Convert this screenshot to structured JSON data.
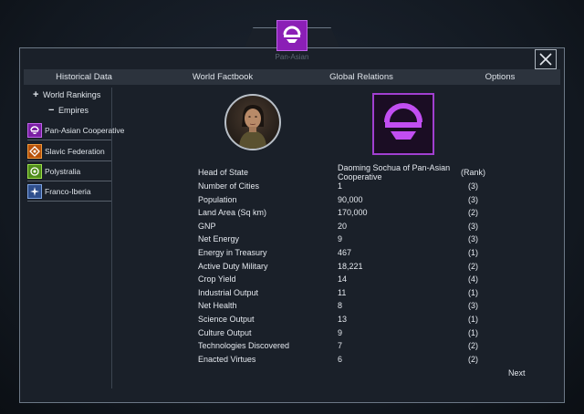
{
  "header": {
    "caption": "Pan-Asian"
  },
  "tabs": [
    {
      "label": "Historical Data"
    },
    {
      "label": "World Factbook"
    },
    {
      "label": "Global Relations"
    },
    {
      "label": "Options"
    }
  ],
  "sidebar": {
    "world_rankings": {
      "symbol": "+",
      "label": "World Rankings"
    },
    "empires_toggle": {
      "symbol": "−",
      "label": "Empires"
    },
    "empires": [
      {
        "label": "Pan-Asian Cooperative",
        "color": "#a62bd4"
      },
      {
        "label": "Slavic Federation",
        "color": "#e07a12"
      },
      {
        "label": "Polystralia",
        "color": "#7bc62a"
      },
      {
        "label": "Franco-Iberia",
        "color": "#4f78c6"
      }
    ]
  },
  "leader": {
    "label": "Head of State",
    "value": "Daoming Sochua of Pan-Asian Cooperative",
    "rank_header": "(Rank)"
  },
  "stats": [
    {
      "label": "Number of Cities",
      "value": "1",
      "rank": "(3)"
    },
    {
      "label": "Population",
      "value": "90,000",
      "rank": "(3)"
    },
    {
      "label": "Land Area (Sq km)",
      "value": "170,000",
      "rank": "(2)"
    },
    {
      "label": "GNP",
      "value": "20",
      "rank": "(3)"
    },
    {
      "label": "Net Energy",
      "value": "9",
      "rank": "(3)"
    },
    {
      "label": "Energy in Treasury",
      "value": "467",
      "rank": "(1)"
    },
    {
      "label": "Active Duty Military",
      "value": "18,221",
      "rank": "(2)"
    },
    {
      "label": "Crop Yield",
      "value": "14",
      "rank": "(4)"
    },
    {
      "label": "Industrial Output",
      "value": "11",
      "rank": "(1)"
    },
    {
      "label": "Net Health",
      "value": "8",
      "rank": "(3)"
    },
    {
      "label": "Science Output",
      "value": "13",
      "rank": "(1)"
    },
    {
      "label": "Culture Output",
      "value": "9",
      "rank": "(1)"
    },
    {
      "label": "Technologies Discovered",
      "value": "7",
      "rank": "(2)"
    },
    {
      "label": "Enacted Virtues",
      "value": "6",
      "rank": "(2)"
    }
  ],
  "footer": {
    "next_label": "Next"
  },
  "colors": {
    "accent": "#a62bd4",
    "panel": "#1a2029",
    "border": "#6c7886"
  }
}
